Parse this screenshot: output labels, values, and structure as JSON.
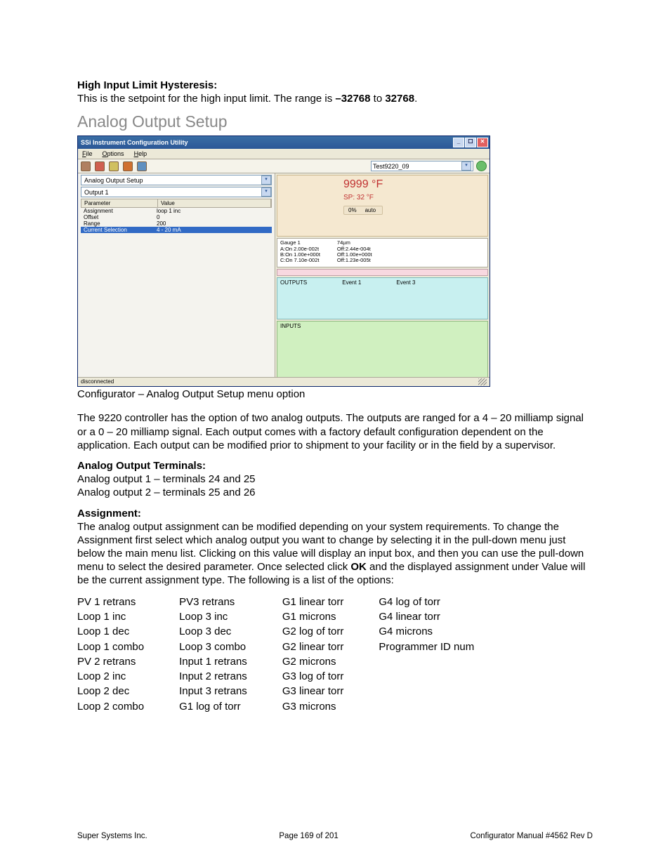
{
  "header1_title": "High Input Limit Hysteresis:",
  "header1_text_pre": "This is the setpoint for the high input limit.  The range is ",
  "header1_bold1": "–32768",
  "header1_mid": " to ",
  "header1_bold2": "32768",
  "header1_end": ".",
  "section_title": "Analog Output Setup",
  "app": {
    "title": "SSi Instrument Configuration Utility",
    "menu": [
      "File",
      "Options",
      "Help"
    ],
    "config_dd": "Test9220_09",
    "combo1": "Analog Output Setup",
    "combo2": "Output 1",
    "param_headers": [
      "Parameter",
      "Value"
    ],
    "params": [
      {
        "p": "Assignment",
        "v": "loop 1 inc"
      },
      {
        "p": "Offset",
        "v": "0"
      },
      {
        "p": "Range",
        "v": "200"
      },
      {
        "p": "Current Selection",
        "v": "4 - 20 mA",
        "sel": true
      }
    ],
    "tempval": "9999 °F",
    "spval": "SP: 32 °F",
    "pct": "0%",
    "auto": "auto",
    "gauge_left": [
      "Gauge 1",
      "A:On 2.00e-002t",
      "B:On 1.00e+000t",
      "C:On 7.10e-002t"
    ],
    "gauge_right": [
      "74µm",
      "Off:2.44e-004t",
      "Off:1.00e+000t",
      "Off:1.23e-005t"
    ],
    "outputs_label": "OUTPUTS",
    "outputs_ev1": "Event 1",
    "outputs_ev3": "Event 3",
    "inputs_label": "INPUTS",
    "status": "disconnected"
  },
  "caption": "Configurator – Analog Output Setup menu option",
  "para_after_img": "The 9220 controller has the option of two analog outputs. The outputs are ranged for a 4 – 20 milliamp signal or a 0 – 20 milliamp signal. Each output comes with a factory default configuration dependent on the application. Each output can be modified prior to shipment to your facility or in the field by a supervisor.",
  "terminals_title": "Analog Output Terminals:",
  "terminals_l1": "Analog output 1 – terminals 24 and 25",
  "terminals_l2": "Analog output 2 – terminals 25 and 26",
  "assign_title": "Assignment:",
  "assign_para_pre": "The analog output assignment can be modified depending on your system requirements. To change the Assignment first select which analog output you want to change by selecting it in the pull-down menu just below the main menu list.  Clicking on this value will display an input box, and then you can use the pull-down menu to select the desired parameter. Once selected click ",
  "assign_ok": "OK",
  "assign_para_post": " and the displayed assignment under Value will be the current assignment type. The following is a list of the options:",
  "options": {
    "col1": [
      "PV 1 retrans",
      "Loop 1 inc",
      "Loop 1 dec",
      "Loop 1 combo",
      "PV 2 retrans",
      "Loop 2 inc",
      "Loop 2 dec",
      "Loop 2 combo"
    ],
    "col2": [
      "PV3 retrans",
      "Loop 3 inc",
      "Loop 3 dec",
      "Loop 3 combo",
      "Input 1 retrans",
      "Input 2 retrans",
      "Input 3 retrans",
      "G1 log of torr"
    ],
    "col3": [
      "G1 linear torr",
      "G1 microns",
      "G2 log of torr",
      "G2 linear torr",
      "G2 microns",
      "G3 log of torr",
      "G3 linear torr",
      "G3 microns"
    ],
    "col4": [
      "G4 log of torr",
      "G4 linear torr",
      "G4 microns",
      "Programmer ID num"
    ]
  },
  "footer": {
    "left": "Super Systems Inc.",
    "center": "Page 169 of 201",
    "right": "Configurator Manual #4562 Rev D"
  }
}
